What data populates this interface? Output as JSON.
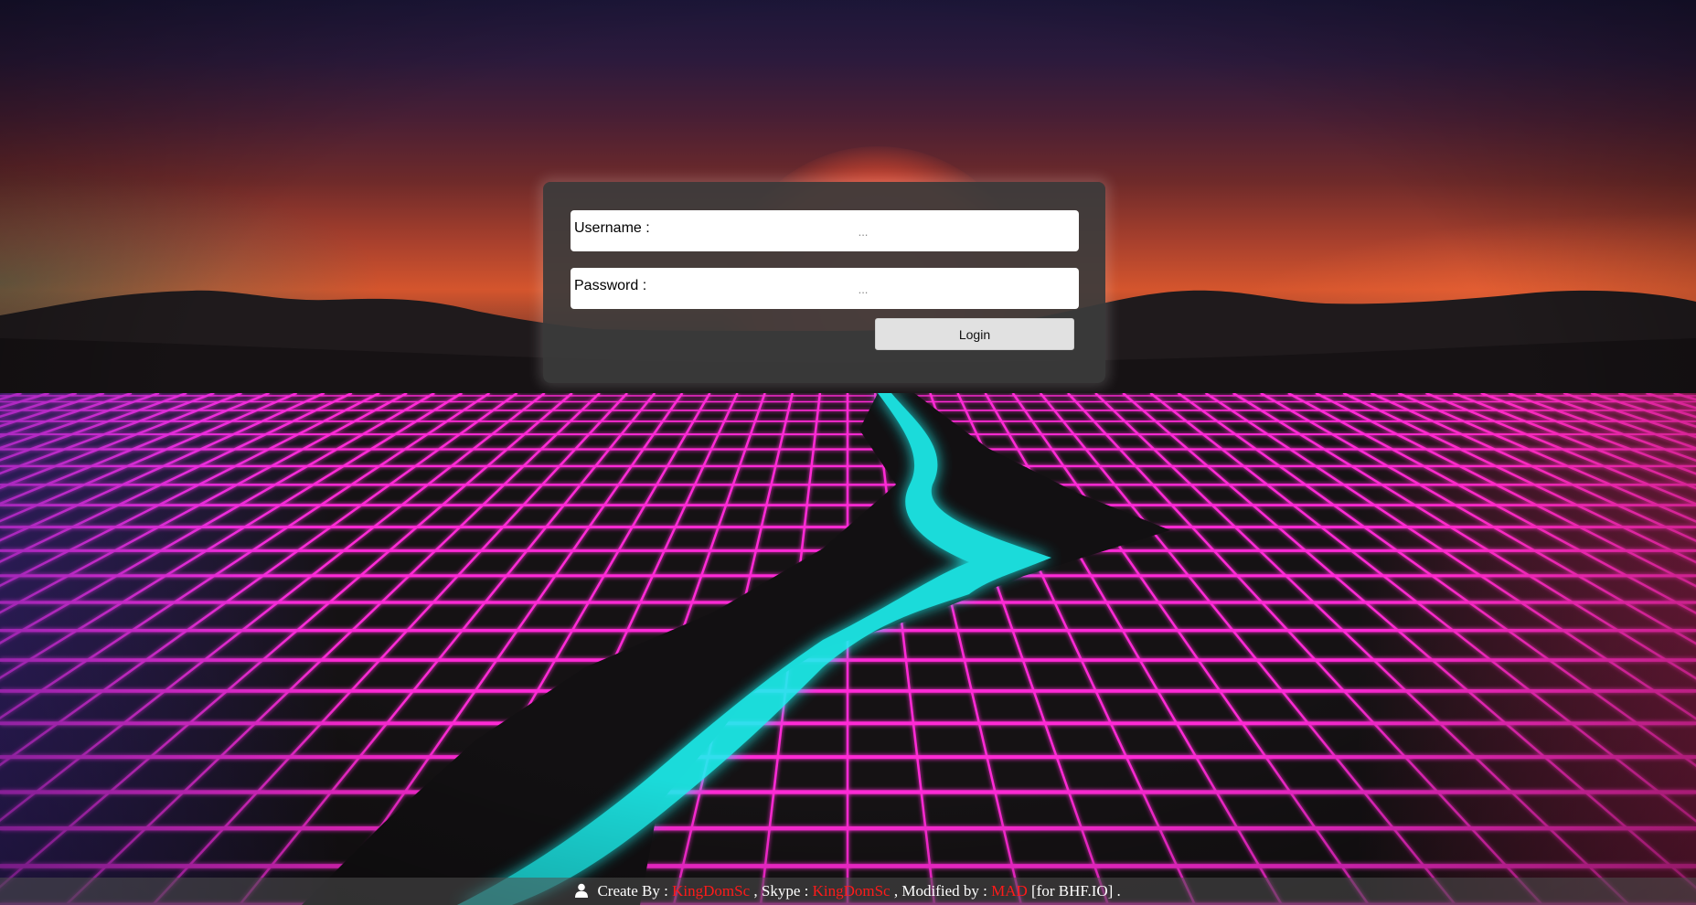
{
  "login": {
    "username_label": "Username :",
    "username_placeholder": "...",
    "password_label": "Password :",
    "password_placeholder": "...",
    "button_label": "Login"
  },
  "footer": {
    "icon": "user-icon",
    "create_by_label": "Create By :",
    "creator_name": "KingDomSc",
    "skype_label": ", Skype :",
    "skype_name": "KingDomSc",
    "modified_by_label": ", Modified by :",
    "modifier_name": "MAD",
    "suffix": "[for BHF.IO] .",
    "highlight_color": "#ff1a1a"
  },
  "theme": {
    "grid_color": "#ff2bd6",
    "river_color": "#1ff2f0",
    "panel_color": "#3c3c3c"
  }
}
